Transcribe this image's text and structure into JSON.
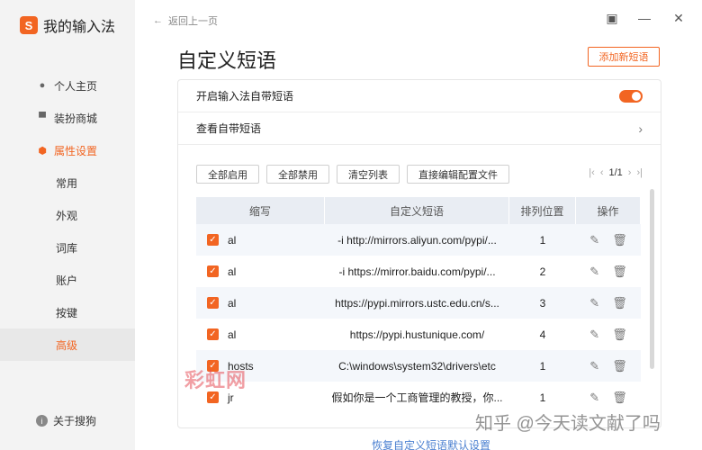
{
  "app": {
    "title": "我的输入法",
    "logo_letter": "S",
    "brand_color": "#f26522"
  },
  "sidebar": {
    "items": [
      {
        "label": "个人主页",
        "icon": "person-icon"
      },
      {
        "label": "装扮商城",
        "icon": "shirt-icon"
      },
      {
        "label": "属性设置",
        "icon": "hexagon-gear-icon"
      }
    ],
    "sub_items": [
      "常用",
      "外观",
      "词库",
      "账户",
      "按键",
      "高级"
    ],
    "bottom": {
      "label": "关于搜狗",
      "icon": "info-icon"
    }
  },
  "topbar": {
    "back_label": "返回上一页"
  },
  "page": {
    "title": "自定义短语",
    "add_label": "添加新短语",
    "enable_label": "开启输入法自带短语",
    "view_label": "查看自带短语",
    "restore_label": "恢复自定义短语默认设置"
  },
  "actions": {
    "enable_all": "全部启用",
    "disable_all": "全部禁用",
    "clear_list": "清空列表",
    "edit_config": "直接编辑配置文件"
  },
  "pager": {
    "text": "1/1"
  },
  "table": {
    "headers": [
      "缩写",
      "自定义短语",
      "排列位置",
      "操作"
    ],
    "rows": [
      {
        "abbr": "al",
        "phrase": "-i http://mirrors.aliyun.com/pypi/...",
        "pos": "1"
      },
      {
        "abbr": "al",
        "phrase": "-i https://mirror.baidu.com/pypi/...",
        "pos": "2"
      },
      {
        "abbr": "al",
        "phrase": "https://pypi.mirrors.ustc.edu.cn/s...",
        "pos": "3"
      },
      {
        "abbr": "al",
        "phrase": "https://pypi.hustunique.com/",
        "pos": "4"
      },
      {
        "abbr": "hosts",
        "phrase": "C:\\windows\\system32\\drivers\\etc",
        "pos": "1"
      },
      {
        "abbr": "jr",
        "phrase": "假如你是一个工商管理的教授，你...",
        "pos": "1"
      }
    ]
  },
  "watermarks": {
    "zhihu": "知乎 @今天读文献了吗",
    "red": "彩虹网"
  }
}
